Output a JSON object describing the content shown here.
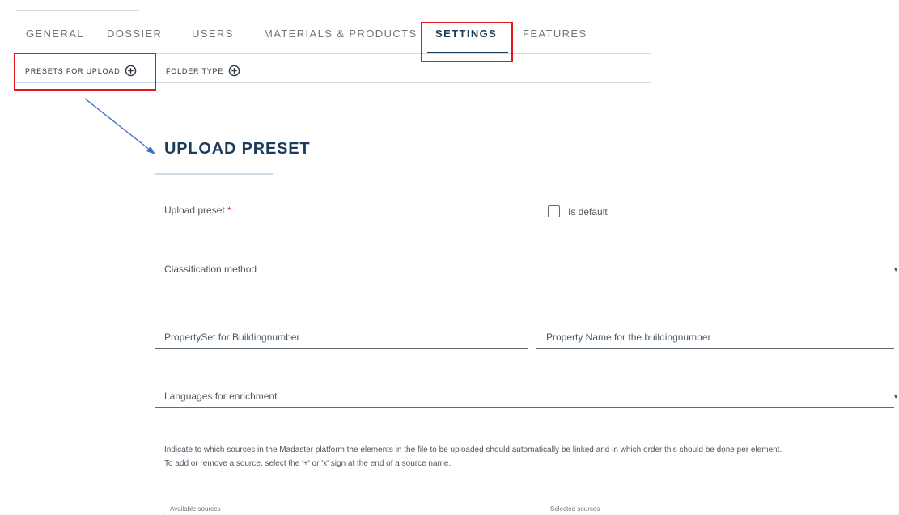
{
  "tabs": [
    {
      "label": "GENERAL"
    },
    {
      "label": "DOSSIER"
    },
    {
      "label": "USERS"
    },
    {
      "label": "MATERIALS & PRODUCTS"
    },
    {
      "label": "SETTINGS"
    },
    {
      "label": "FEATURES"
    }
  ],
  "subtabs": [
    {
      "label": "PRESETS FOR UPLOAD",
      "icon": "plus-circle-icon"
    },
    {
      "label": "FOLDER TYPE",
      "icon": "plus-circle-icon"
    }
  ],
  "form": {
    "title": "UPLOAD PRESET",
    "upload_preset_label": "Upload preset",
    "required_mark": "*",
    "is_default_label": "Is default",
    "is_default_checked": false,
    "classification_label": "Classification method",
    "propertyset_label": "PropertySet for Buildingnumber",
    "property_name_label": "Property Name for the buildingnumber",
    "languages_label": "Languages for enrichment",
    "help_line1": "Indicate to which sources in the Madaster platform the elements in the file to be uploaded should automatically be linked and in which order this should be done per element.",
    "help_line2": "To add or remove a source, select the '+' or 'x' sign at the end of a source name.",
    "available_sources_label": "Available sources",
    "selected_sources_label": "Selected sources"
  },
  "colors": {
    "accent": "#1c3c5a",
    "annotation_box": "#e3161b",
    "annotation_arrow": "#3a6fc4"
  }
}
